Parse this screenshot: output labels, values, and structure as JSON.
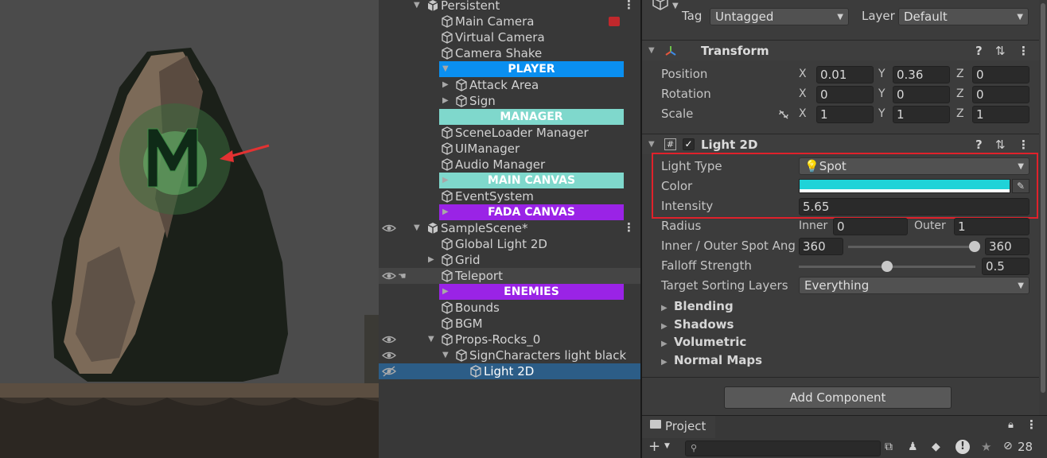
{
  "hierarchy": {
    "rows": [
      {
        "label": "Persistent",
        "type": "scene",
        "bold": false,
        "expanded": true
      },
      {
        "label": "Main Camera",
        "type": "object"
      },
      {
        "label": "Virtual Camera",
        "type": "object"
      },
      {
        "label": "Camera Shake",
        "type": "object"
      },
      {
        "label": "PLAYER",
        "type": "header",
        "color": "#0a8ff0"
      },
      {
        "label": "Attack Area",
        "type": "object"
      },
      {
        "label": "Sign",
        "type": "object"
      },
      {
        "label": "MANAGER",
        "type": "header",
        "color": "#7fd8cc"
      },
      {
        "label": "SceneLoader Manager",
        "type": "object"
      },
      {
        "label": "UIManager",
        "type": "object"
      },
      {
        "label": "Audio Manager",
        "type": "object"
      },
      {
        "label": "MAIN CANVAS",
        "type": "header",
        "color": "#7fd8cc"
      },
      {
        "label": "EventSystem",
        "type": "object"
      },
      {
        "label": "FADA CANVAS",
        "type": "header",
        "color": "#9a23e6"
      },
      {
        "label": "SampleScene*",
        "type": "scene"
      },
      {
        "label": "Global Light 2D",
        "type": "object"
      },
      {
        "label": "Grid",
        "type": "object"
      },
      {
        "label": "Teleport",
        "type": "object"
      },
      {
        "label": "ENEMIES",
        "type": "header",
        "color": "#9a23e6"
      },
      {
        "label": "Bounds",
        "type": "object"
      },
      {
        "label": "BGM",
        "type": "object"
      },
      {
        "label": "Props-Rocks_0",
        "type": "object"
      },
      {
        "label": "SignCharacters light black",
        "type": "object"
      },
      {
        "label": "Light 2D",
        "type": "object"
      }
    ]
  },
  "inspector": {
    "tag_label": "Tag",
    "tag_value": "Untagged",
    "layer_label": "Layer",
    "layer_value": "Default",
    "transform": {
      "title": "Transform",
      "position_label": "Position",
      "rotation_label": "Rotation",
      "scale_label": "Scale",
      "position": {
        "x": "0.01",
        "y": "0.36",
        "z": "0"
      },
      "rotation": {
        "x": "0",
        "y": "0",
        "z": "0"
      },
      "scale": {
        "x": "1",
        "y": "1",
        "z": "1"
      },
      "axis_x": "X",
      "axis_y": "Y",
      "axis_z": "Z"
    },
    "light2d": {
      "title": "Light 2D",
      "light_type_label": "Light Type",
      "light_type_value": "Spot",
      "color_label": "Color",
      "color_value": "#1fd3d8",
      "intensity_label": "Intensity",
      "intensity_value": "5.65",
      "radius_label": "Radius",
      "inner_label": "Inner",
      "inner_value": "0",
      "outer_label": "Outer",
      "outer_value": "1",
      "spot_angle_label": "Inner / Outer Spot Ang",
      "spot_inner_value": "360",
      "spot_outer_value": "360",
      "falloff_label": "Falloff Strength",
      "falloff_value": "0.5",
      "sorting_label": "Target Sorting Layers",
      "sorting_value": "Everything",
      "sections": [
        "Blending",
        "Shadows",
        "Volumetric",
        "Normal Maps"
      ]
    },
    "add_component": "Add Component"
  },
  "project": {
    "tab_label": "Project",
    "search_placeholder": "",
    "hidden_count": "28"
  },
  "colors": {
    "highlight_box": "#e0212b",
    "selection": "#2c5d87",
    "arrow": "#e23232"
  }
}
